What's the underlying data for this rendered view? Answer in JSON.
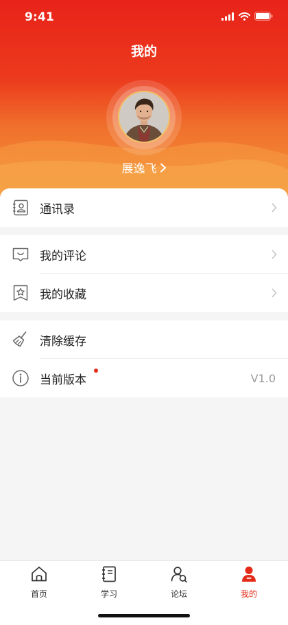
{
  "status_bar": {
    "time": "9:41"
  },
  "header": {
    "title": "我的",
    "user_name": "展逸飞"
  },
  "menu": {
    "groups": [
      [
        {
          "icon": "contacts-icon",
          "label": "通讯录",
          "arrow": true
        }
      ],
      [
        {
          "icon": "comment-icon",
          "label": "我的评论",
          "arrow": true
        },
        {
          "icon": "favorites-icon",
          "label": "我的收藏",
          "arrow": true
        }
      ],
      [
        {
          "icon": "broom-icon",
          "label": "清除缓存",
          "arrow": false
        },
        {
          "icon": "info-icon",
          "label": "当前版本",
          "value": "V1.0",
          "badge_dot": true
        }
      ]
    ]
  },
  "tabbar": {
    "items": [
      {
        "icon": "home-icon",
        "label": "首页",
        "active": false
      },
      {
        "icon": "notebook-icon",
        "label": "学习",
        "active": false
      },
      {
        "icon": "forum-icon",
        "label": "论坛",
        "active": false
      },
      {
        "icon": "user-icon",
        "label": "我的",
        "active": true
      }
    ]
  },
  "colors": {
    "brand_red": "#e32a19",
    "header_gradient": [
      "#e8231a",
      "#f59a3c"
    ],
    "avatar_border": "#f3c064"
  }
}
